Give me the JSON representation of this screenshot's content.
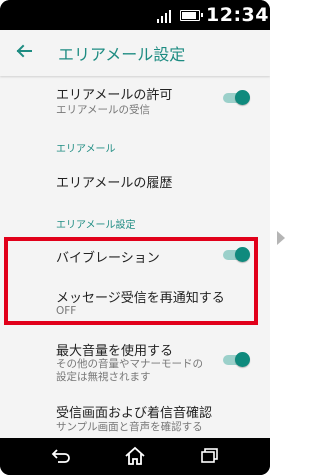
{
  "status_bar": {
    "time": "12:34",
    "signal_icon": "signal-bars-icon",
    "battery_icon": "battery-icon"
  },
  "app_bar": {
    "back_icon": "back-arrow-icon",
    "title": "エリアメール設定"
  },
  "settings": {
    "allow": {
      "title": "エリアメールの許可",
      "subtitle": "エリアメールの受信",
      "toggle_on": true
    },
    "section_area_mail": "エリアメール",
    "history": {
      "title": "エリアメールの履歴"
    },
    "section_area_mail_settings": "エリアメール設定",
    "vibration": {
      "title": "バイブレーション",
      "toggle_on": true
    },
    "renotify": {
      "title": "メッセージ受信を再通知する",
      "subtitle": "OFF"
    },
    "max_volume": {
      "title": "最大音量を使用する",
      "subtitle_line1": "その他の音量やマナーモードの",
      "subtitle_line2": "設定は無視されます",
      "toggle_on": true
    },
    "confirm": {
      "title": "受信画面および着信音確認",
      "subtitle": "サンプル画面と音声を確認する"
    }
  },
  "colors": {
    "accent": "#1e8c82",
    "toggle_knob": "#0f8a7d",
    "toggle_track": "#9bd0ca",
    "highlight": "#e1001a"
  },
  "nav_bar": {
    "back_icon": "nav-back-icon",
    "home_icon": "nav-home-icon",
    "recents_icon": "nav-recents-icon"
  }
}
